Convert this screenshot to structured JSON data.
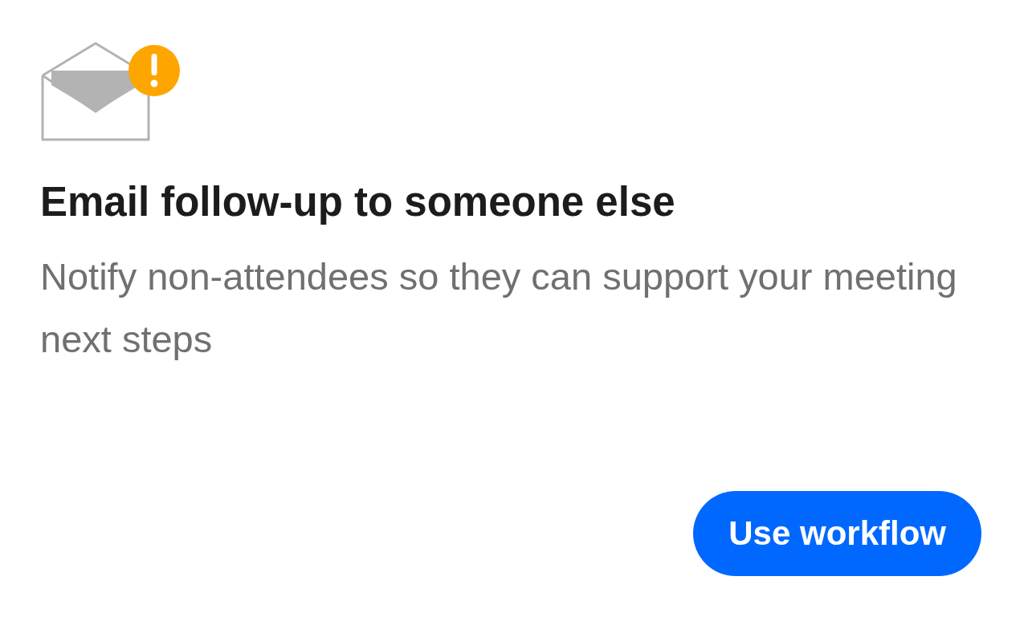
{
  "card": {
    "title": "Email follow-up to someone else",
    "description": "Notify non-attendees so they can support your meeting next steps",
    "button": "Use workflow"
  }
}
